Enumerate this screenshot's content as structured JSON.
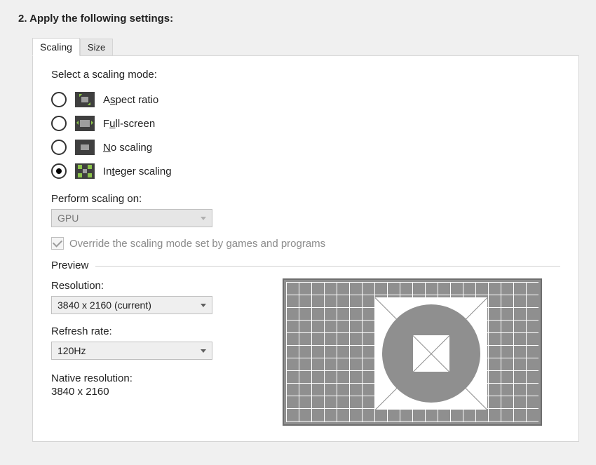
{
  "section_title": "2. Apply the following settings:",
  "tabs": {
    "scaling": "Scaling",
    "size": "Size",
    "active": "scaling"
  },
  "scaling": {
    "select_label": "Select a scaling mode:",
    "modes": {
      "aspect": {
        "pre": "A",
        "mn": "s",
        "post": "pect ratio"
      },
      "full": {
        "pre": "F",
        "mn": "u",
        "post": "ll-screen"
      },
      "noscale": {
        "pre": "",
        "mn": "N",
        "post": "o scaling"
      },
      "integer": {
        "pre": "In",
        "mn": "t",
        "post": "eger scaling"
      }
    },
    "selected_mode": "integer",
    "perform_label": "Perform scaling on:",
    "perform_value": "GPU",
    "override_label": "Override the scaling mode set by games and programs",
    "override_checked": true,
    "override_disabled": true
  },
  "preview": {
    "heading": "Preview",
    "resolution_label": "Resolution:",
    "resolution_value": "3840 x 2160 (current)",
    "refresh_label": "Refresh rate:",
    "refresh_value": "120Hz",
    "native_label": "Native resolution:",
    "native_value": "3840 x 2160"
  }
}
